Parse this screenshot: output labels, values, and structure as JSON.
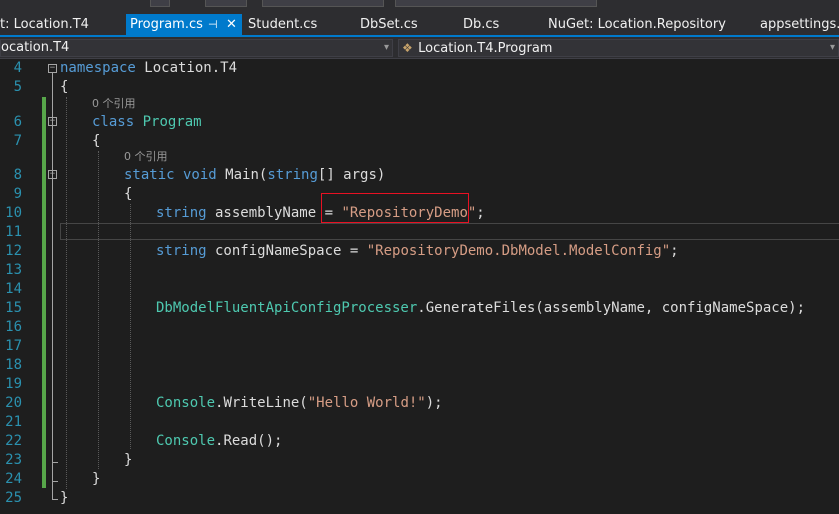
{
  "tabs": [
    {
      "label": "t: Location.T4"
    },
    {
      "label": "Program.cs",
      "active": true,
      "pin": "⊣",
      "close": "✕"
    },
    {
      "label": "Student.cs"
    },
    {
      "label": "DbSet.cs"
    },
    {
      "label": "Db.cs"
    },
    {
      "label": "NuGet: Location.Repository"
    },
    {
      "label": "appsettings.js"
    }
  ],
  "nav": {
    "project_dropdown": "ocation.T4",
    "member_dropdown": "Location.T4.Program",
    "arrow": "▾"
  },
  "editor": {
    "line_numbers": [
      "4",
      "5",
      "6",
      "7",
      "8",
      "9",
      "10",
      "11",
      "12",
      "13",
      "14",
      "15",
      "16",
      "17",
      "18",
      "19",
      "20",
      "21",
      "22",
      "23",
      "24",
      "25"
    ],
    "codelens": {
      "class_refs": "0 个引用",
      "method_refs": "0 个引用"
    },
    "code": {
      "l4_kw": "namespace",
      "l4_rest": " Location.T4",
      "l5": "{",
      "l6_kw": "class",
      "l6_ty": " Program",
      "l7": "{",
      "l8_kw1": "static",
      "l8_kw2": " void",
      "l8_name": " Main(",
      "l8_kw3": "string",
      "l8_rest": "[] args)",
      "l9": "{",
      "l10_kw": "string",
      "l10_mid": " assemblyName = ",
      "l10_str": "\"RepositoryDemo\"",
      "l10_end": ";",
      "l12_kw": "string",
      "l12_mid": " configNameSpace = ",
      "l12_str": "\"RepositoryDemo.DbModel.ModelConfig\"",
      "l12_end": ";",
      "l15_ty": "DbModelFluentApiConfigProcesser",
      "l15_rest": ".GenerateFiles(assemblyName, configNameSpace);",
      "l20_ty": "Console",
      "l20_mid": ".WriteLine(",
      "l20_str": "\"Hello World!\"",
      "l20_end": ");",
      "l22_ty": "Console",
      "l22_rest": ".Read();",
      "l23": "}",
      "l24": "}",
      "l25": "}"
    }
  },
  "colors": {
    "background": "#1e1e1e",
    "keyword": "#569cd6",
    "type": "#4ec9b0",
    "string": "#d69d85",
    "line_number": "#2b91af",
    "tab_active": "#007acc",
    "change_marker": "#57a64a",
    "annotation_box": "#e81123"
  }
}
